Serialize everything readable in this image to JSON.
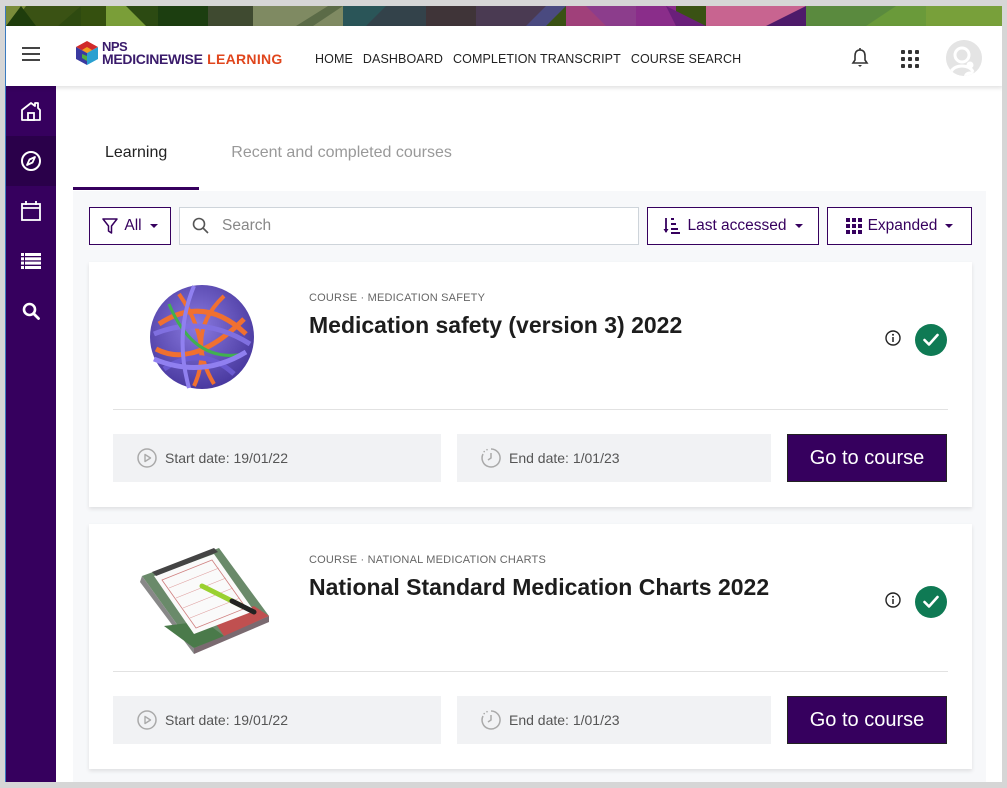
{
  "brand": {
    "logo_top": "NPS",
    "logo_main": "MEDICINEWISE",
    "logo_accent": "LEARNING",
    "accent_color": "#36005e",
    "logo_orange": "#e0461d"
  },
  "nav": {
    "links": [
      "HOME",
      "DASHBOARD",
      "COMPLETION TRANSCRIPT",
      "COURSE SEARCH"
    ],
    "icons": [
      "bell-icon",
      "apps-grid-icon",
      "user-avatar"
    ]
  },
  "sidebar": {
    "items": [
      {
        "icon": "home-icon",
        "active": false
      },
      {
        "icon": "compass-icon",
        "active": true
      },
      {
        "icon": "calendar-icon",
        "active": false
      },
      {
        "icon": "list-icon",
        "active": false
      },
      {
        "icon": "search-icon",
        "active": false
      }
    ]
  },
  "tabs": [
    {
      "label": "Learning",
      "active": true
    },
    {
      "label": "Recent and completed courses",
      "active": false
    }
  ],
  "filters": {
    "filter_label": "All",
    "search_placeholder": "Search",
    "search_value": "",
    "sort_label": "Last accessed",
    "view_label": "Expanded"
  },
  "courses": [
    {
      "category": "COURSE · MEDICATION SAFETY",
      "title": "Medication safety (version 3) 2022",
      "completed": true,
      "start_date": "Start date: 19/01/22",
      "end_date": "End date: 1/01/23",
      "button_label": "Go to course",
      "image": "rubber-band-ball"
    },
    {
      "category": "COURSE · NATIONAL MEDICATION CHARTS",
      "title": "National Standard Medication Charts 2022",
      "completed": true,
      "start_date": "Start date: 19/01/22",
      "end_date": "End date: 1/01/23",
      "button_label": "Go to course",
      "image": "clipboard-with-pen"
    }
  ]
}
